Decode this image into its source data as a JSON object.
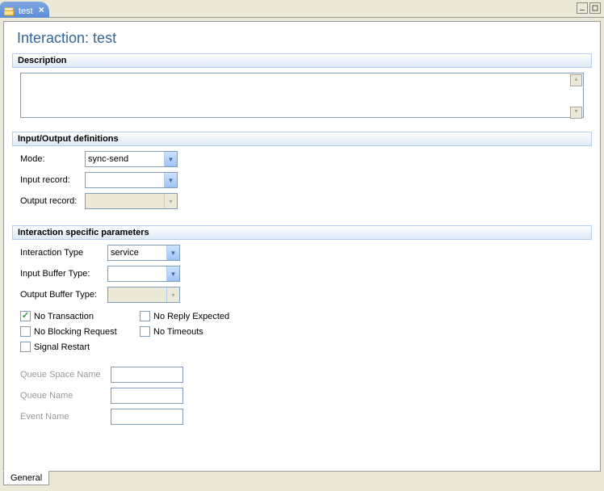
{
  "tab": {
    "title": "test"
  },
  "page": {
    "title": "Interaction: test"
  },
  "sections": {
    "description": {
      "header": "Description",
      "value": ""
    },
    "io": {
      "header": "Input/Output definitions",
      "mode_label": "Mode:",
      "mode_value": "sync-send",
      "input_record_label": "Input record:",
      "input_record_value": "",
      "output_record_label": "Output record:",
      "output_record_value": ""
    },
    "params": {
      "header": "Interaction specific parameters",
      "interaction_type_label": "Interaction Type",
      "interaction_type_value": "service",
      "input_buffer_label": "Input Buffer Type:",
      "input_buffer_value": "",
      "output_buffer_label": "Output Buffer Type:",
      "output_buffer_value": "",
      "no_transaction": "No Transaction",
      "no_reply": "No Reply Expected",
      "no_blocking": "No Blocking Request",
      "no_timeouts": "No Timeouts",
      "signal_restart": "Signal Restart",
      "queue_space_label": "Queue Space Name",
      "queue_space_value": "",
      "queue_name_label": "Queue Name",
      "queue_name_value": "",
      "event_name_label": "Event Name",
      "event_name_value": ""
    }
  },
  "bottom_tab": {
    "general": "General"
  }
}
